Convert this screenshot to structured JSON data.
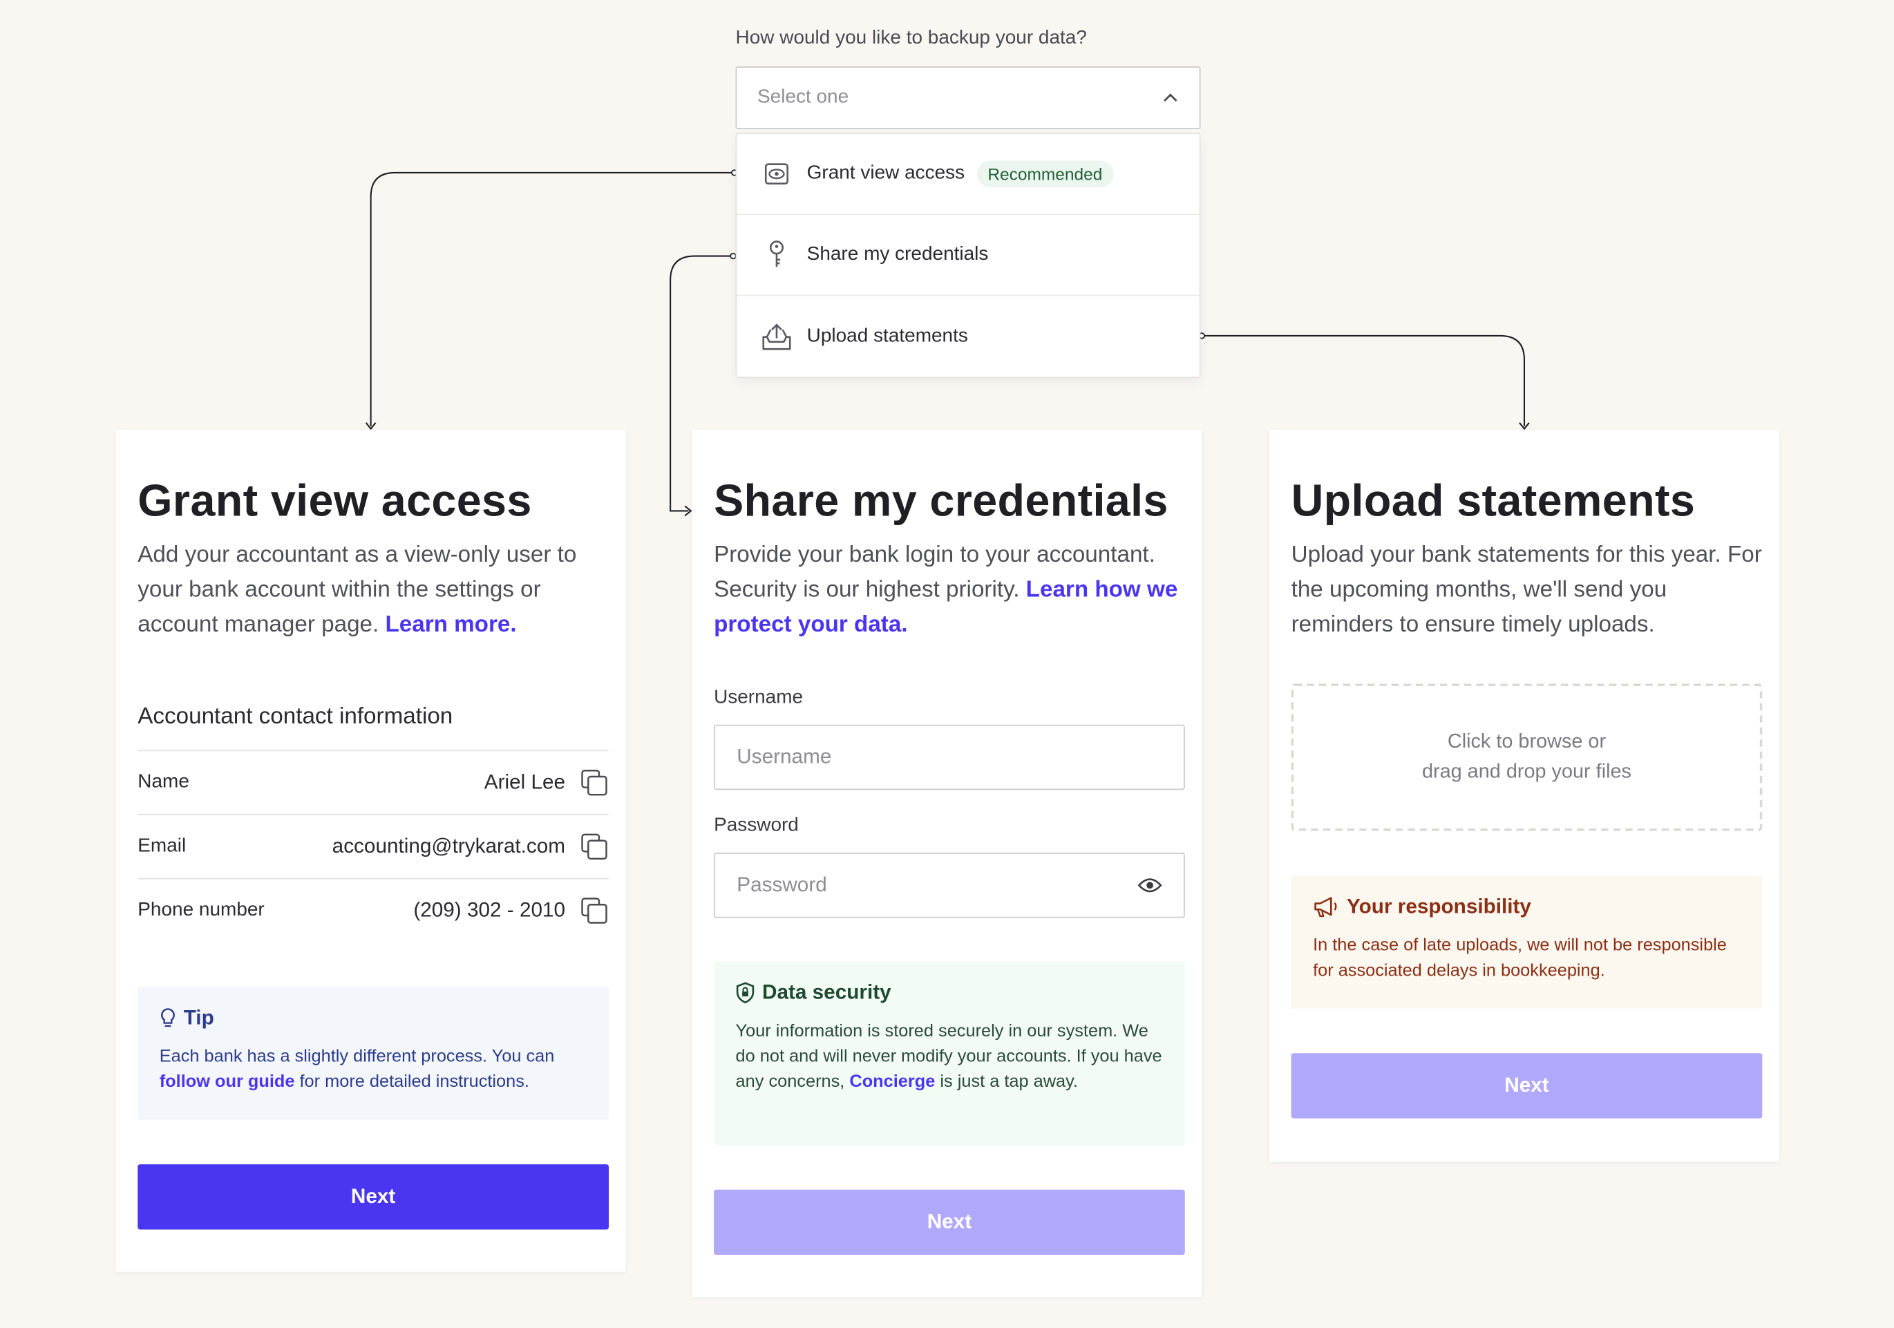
{
  "colors": {
    "accent": "#4a35f0",
    "accent_disabled": "#b0a8fb",
    "background": "#faf7f3"
  },
  "dropdown": {
    "question": "How would you like to backup your data?",
    "placeholder": "Select one",
    "state": "open",
    "options": [
      {
        "label": "Grant view access",
        "icon": "eye-icon",
        "badge": "Recommended"
      },
      {
        "label": "Share my credentials",
        "icon": "key-icon"
      },
      {
        "label": "Upload statements",
        "icon": "upload-tray-icon"
      }
    ]
  },
  "grant": {
    "title": "Grant view access",
    "desc": "Add your accountant as a view-only user to your bank account within the settings or account manager page.",
    "link": "Learn more.",
    "contact_title": "Accountant contact information",
    "rows": [
      {
        "label": "Name",
        "value": "Ariel Lee"
      },
      {
        "label": "Email",
        "value": "accounting@trykarat.com"
      },
      {
        "label": "Phone number",
        "value": "(209) 302 - 2010"
      }
    ],
    "tip": {
      "title": "Tip",
      "text_before": "Each bank has a slightly different process. You can ",
      "link": "follow our guide",
      "text_after": " for more detailed instructions."
    },
    "next": "Next"
  },
  "credentials": {
    "title": "Share my credentials",
    "desc": "Provide your bank login to your accountant. Security is our highest priority.",
    "link": "Learn how we protect your data.",
    "username_label": "Username",
    "username_placeholder": "Username",
    "password_label": "Password",
    "password_placeholder": "Password",
    "security": {
      "title": "Data security",
      "text_before": "Your information is stored securely in our system. We do not and will never modify your accounts. If you have any concerns, ",
      "link": "Concierge",
      "text_after": " is just a tap away."
    },
    "next": "Next"
  },
  "upload": {
    "title": "Upload statements",
    "desc": "Upload your bank statements for this year. For the upcoming months, we'll send you reminders to ensure timely uploads.",
    "drop_line1": "Click to browse or",
    "drop_line2": "drag and drop your files",
    "responsibility": {
      "title": "Your responsibility",
      "text": "In the case of late uploads, we will not be responsible for associated delays in bookkeeping."
    },
    "next": "Next"
  }
}
